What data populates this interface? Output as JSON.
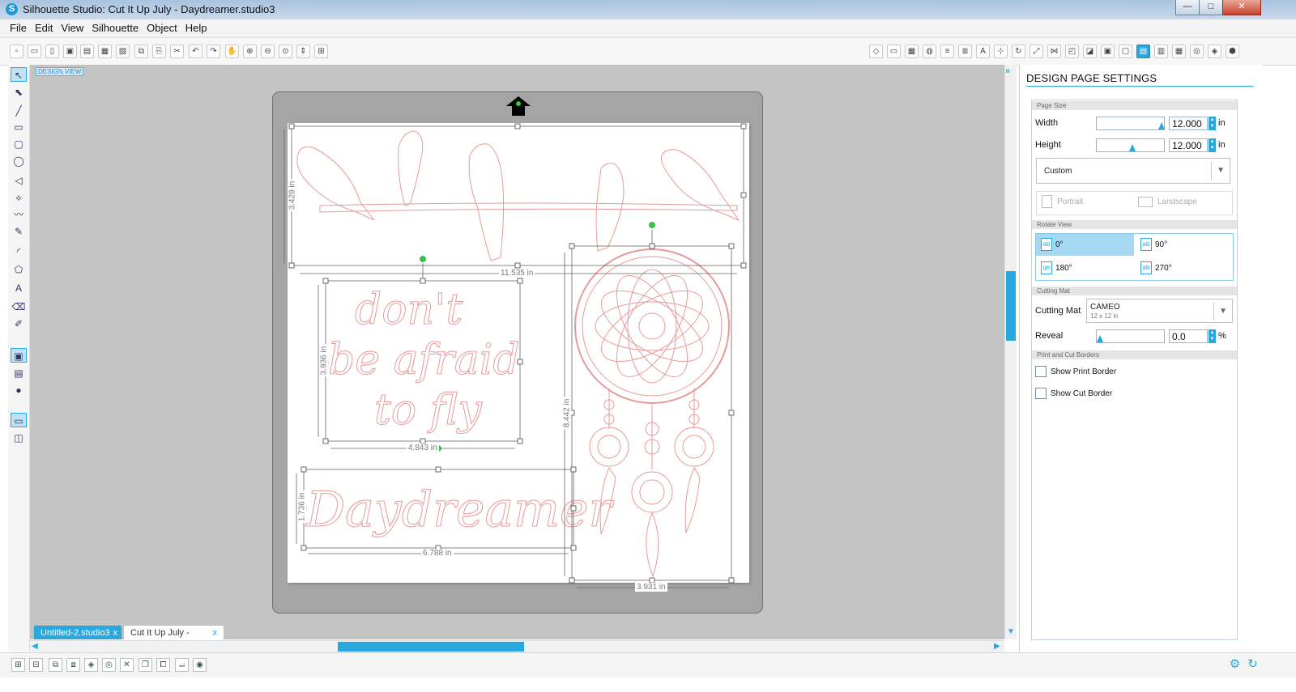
{
  "window": {
    "title": "Silhouette Studio: Cut It Up July - Daydreamer.studio3",
    "app_icon": "S",
    "controls": {
      "minimize": "—",
      "maximize": "□",
      "close": "✕"
    }
  },
  "menu": [
    "File",
    "Edit",
    "View",
    "Silhouette",
    "Object",
    "Help"
  ],
  "toolbar": {
    "left_icons": [
      "new-file-icon",
      "open-folder-icon",
      "open-library-icon",
      "save-icon",
      "save-to-library-icon",
      "print-icon",
      "print-cut-icon",
      "copy-icon",
      "paste-icon",
      "cut-icon",
      "undo-icon",
      "redo-icon",
      "pan-hand-icon",
      "zoom-in-icon",
      "zoom-out-icon",
      "zoom-select-icon",
      "zoom-drag-icon",
      "fit-to-page-icon"
    ],
    "left_glyphs": [
      "▫",
      "▭",
      "▯",
      "▣",
      "▤",
      "▦",
      "▧",
      "⧉",
      "⎘",
      "✂",
      "↶",
      "↷",
      "✋",
      "⊕",
      "⊖",
      "⊙",
      "⇕",
      "⊞"
    ],
    "right_icons": [
      "fill-color-icon",
      "line-color-icon",
      "fill-pattern-icon",
      "fill-gradient-icon",
      "line-style-icon",
      "line-options-icon",
      "text-style-icon",
      "align-icon",
      "replicate-icon",
      "transform-icon",
      "modify-icon",
      "offset-icon",
      "trace-icon",
      "print-border-icon",
      "registration-icon",
      "page-settings-icon",
      "cut-settings-icon",
      "grid-icon",
      "pixel-scan-icon",
      "silhouette-store-icon",
      "send-to-silhouette-icon"
    ],
    "right_glyphs": [
      "◇",
      "▭",
      "▦",
      "◍",
      "≡",
      "≣",
      "A",
      "⊹",
      "↻",
      "⤢",
      "⋈",
      "◰",
      "◪",
      "▣",
      "▢",
      "▤",
      "▥",
      "▦",
      "◎",
      "◈",
      "⬢"
    ],
    "active_right": "page-settings-icon"
  },
  "left_tools": {
    "icons": [
      "select-icon",
      "point-edit-icon",
      "line-icon",
      "rectangle-icon",
      "rounded-rect-icon",
      "ellipse-icon",
      "polygon-icon",
      "curve-icon",
      "freehand-icon",
      "smooth-freehand-icon",
      "arc-icon",
      "regular-polygon-icon",
      "text-icon",
      "eraser-icon",
      "knife-icon",
      "design-view-icon",
      "library-icon",
      "store-icon",
      "single-view-icon",
      "split-view-icon"
    ],
    "glyphs": [
      "↖",
      "⬉",
      "╱",
      "▭",
      "▢",
      "◯",
      "◁",
      "⟡",
      "〰",
      "✎",
      "◜",
      "⬠",
      "A",
      "⌫",
      "✐",
      "▣",
      "▤",
      "●",
      "▭",
      "◫"
    ]
  },
  "canvas": {
    "design_view_label": "DESIGN VIEW",
    "page_background": "#ffffff",
    "mat_color": "#a5a5a5",
    "cut_line_color": "#e89a9a",
    "dimensions": {
      "birds_height": "3.429 in",
      "birds_width": "11.535 in",
      "text_block_height": "3.936 in",
      "text_block_width": "4.843 in",
      "daydreamer_height": "1.736 in",
      "daydreamer_width": "6.788 in",
      "dreamcatcher_height": "8.442 in",
      "dreamcatcher_width": "3.931 in"
    },
    "quote_lines": [
      "don't",
      "be afraid",
      "to fly"
    ],
    "word_art": "Daydreamer"
  },
  "tabs": [
    {
      "label": "Untitled-2.studio3",
      "close": "x",
      "active": true
    },
    {
      "label": "Cut It Up July - Dayd...",
      "close": "x",
      "active": false
    }
  ],
  "bottom_toolbar": {
    "icons": [
      "group-icon",
      "ungroup-icon",
      "make-compound-icon",
      "release-compound-icon",
      "weld-icon",
      "select-all-icon",
      "delete-icon",
      "duplicate-icon",
      "bring-to-front-icon",
      "send-to-back-icon",
      "offset-shadow-icon"
    ],
    "glyphs": [
      "⊞",
      "⊟",
      "⧉",
      "⧈",
      "◈",
      "◎",
      "✕",
      "❐",
      "⧠",
      "⧡",
      "◉"
    ],
    "right_icons": [
      "settings-gear-icon",
      "refresh-icon"
    ],
    "right_glyphs": [
      "⚙",
      "↻"
    ]
  },
  "panel": {
    "title": "DESIGN PAGE SETTINGS",
    "collapse_glyph": "»",
    "page_size": {
      "header": "Page Size",
      "width_label": "Width",
      "width_value": "12.000",
      "height_label": "Height",
      "height_value": "12.000",
      "unit": "in",
      "preset": "Custom",
      "portrait": "Portrait",
      "landscape": "Landscape"
    },
    "rotate_view": {
      "header": "Rotate View",
      "options": [
        "0°",
        "90°",
        "180°",
        "270°"
      ],
      "selected": "0°"
    },
    "cutting_mat": {
      "header": "Cutting Mat",
      "label": "Cutting Mat",
      "value": "CAMEO",
      "sub": "12 x 12 in",
      "reveal_label": "Reveal",
      "reveal_value": "0.0",
      "reveal_unit": "%"
    },
    "borders": {
      "header": "Print and Cut Borders",
      "print": "Show Print Border",
      "cut": "Show Cut Border"
    }
  },
  "colors": {
    "accent": "#29a8e0",
    "cut_line": "#e89a9a",
    "title_bar": "#b9cfe4"
  }
}
